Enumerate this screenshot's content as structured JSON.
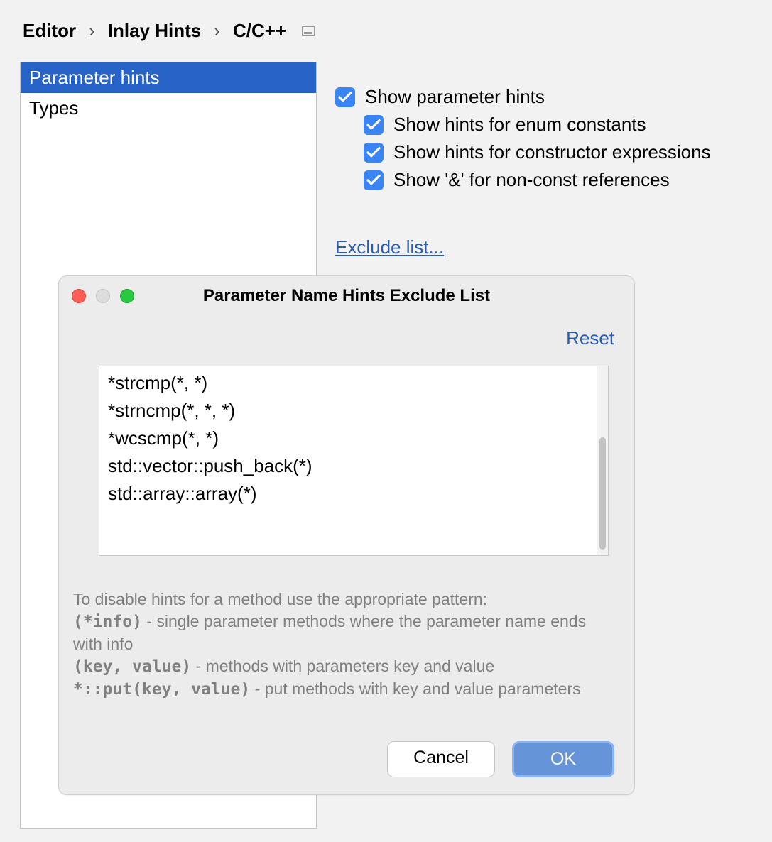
{
  "breadcrumb": {
    "editor": "Editor",
    "inlay": "Inlay Hints",
    "lang": "C/C++"
  },
  "sidebar": {
    "items": [
      {
        "label": "Parameter hints",
        "selected": true
      },
      {
        "label": "Types",
        "selected": false
      }
    ]
  },
  "options": {
    "show_param_hints": "Show parameter hints",
    "enum_constants": "Show hints for enum constants",
    "constructor_expr": "Show hints for constructor expressions",
    "nonconst_ref": "Show '&' for non-const references",
    "checked": {
      "show_param_hints": true,
      "enum_constants": true,
      "constructor_expr": true,
      "nonconst_ref": true
    }
  },
  "exclude_link": "Exclude list...",
  "dialog": {
    "title": "Parameter Name Hints Exclude List",
    "reset": "Reset",
    "patterns": "*strcmp(*, *)\n*strncmp(*, *, *)\n*wcscmp(*, *)\nstd::vector::push_back(*)\nstd::array::array(*)",
    "help": {
      "intro": "To disable hints for a method use the appropriate pattern:",
      "ex1_code": "(*info)",
      "ex1_text": " - single parameter methods where the parameter name ends with info",
      "ex2_code": "(key, value)",
      "ex2_text": " - methods with parameters key and value",
      "ex3_code": "*::put(key, value)",
      "ex3_text": " - put methods with key and value parameters"
    },
    "cancel": "Cancel",
    "ok": "OK"
  }
}
